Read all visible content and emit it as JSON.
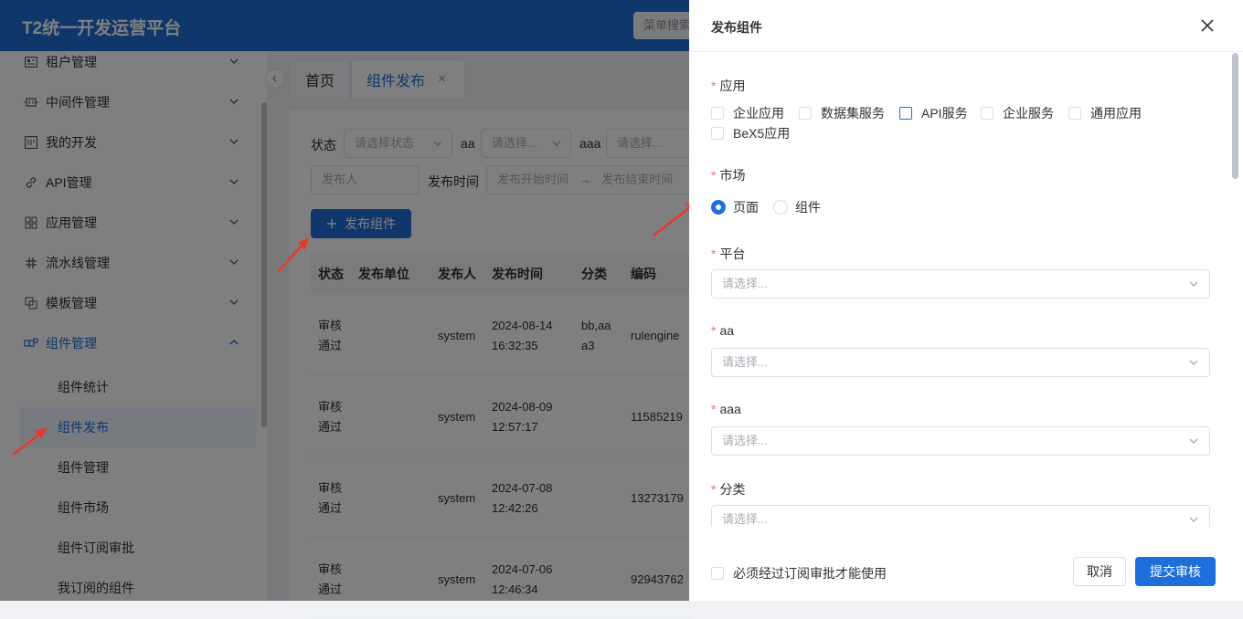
{
  "app": {
    "title": "T2统一开发运营平台",
    "menu_search_placeholder": "菜单搜索"
  },
  "sidebar": {
    "items": [
      {
        "label": "租户管理",
        "icon": "id-card-icon"
      },
      {
        "label": "中间件管理",
        "icon": "middleware-icon"
      },
      {
        "label": "我的开发",
        "icon": "code-window-icon"
      },
      {
        "label": "API管理",
        "icon": "link-icon"
      },
      {
        "label": "应用管理",
        "icon": "grid-icon"
      },
      {
        "label": "流水线管理",
        "icon": "pipeline-icon"
      },
      {
        "label": "模板管理",
        "icon": "template-icon"
      },
      {
        "label": "组件管理",
        "icon": "component-icon"
      }
    ],
    "sub_items": [
      "组件统计",
      "组件发布",
      "组件管理",
      "组件市场",
      "组件订阅审批",
      "我订阅的组件"
    ]
  },
  "tabs": {
    "home": "首页",
    "current": "组件发布",
    "close": "×"
  },
  "filters": {
    "status_label": "状态",
    "status_placeholder": "请选择状态",
    "aa_label": "aa",
    "aa_placeholder": "请选择...",
    "aaa_label": "aaa",
    "aaa_placeholder": "请选择...",
    "publisher_placeholder": "发布人",
    "time_label": "发布时间",
    "time_start": "发布开始时间",
    "time_sep": "→",
    "time_end": "发布结束时间"
  },
  "publish_button": "发布组件",
  "table": {
    "headers": [
      "状态",
      "发布单位",
      "发布人",
      "发布时间",
      "分类",
      "编码"
    ],
    "rows": [
      {
        "status1": "审核",
        "status2": "通过",
        "publisher": "system",
        "date": "2024-08-14",
        "time": "16:32:35",
        "cat1": "bb,aa",
        "cat2": "a3",
        "code": "rulengine"
      },
      {
        "status1": "审核",
        "status2": "通过",
        "publisher": "system",
        "date": "2024-08-09",
        "time": "12:57:17",
        "cat1": "",
        "cat2": "",
        "code": "11585219"
      },
      {
        "status1": "审核",
        "status2": "通过",
        "publisher": "system",
        "date": "2024-07-08",
        "time": "12:42:26",
        "cat1": "",
        "cat2": "",
        "code": "13273179"
      },
      {
        "status1": "审核",
        "status2": "通过",
        "publisher": "system",
        "date": "2024-07-06",
        "time": "12:46:34",
        "cat1": "",
        "cat2": "",
        "code": "92943762"
      }
    ]
  },
  "drawer": {
    "title": "发布组件",
    "required_mark": "*",
    "app_label": "应用",
    "app_options": [
      "企业应用",
      "数据集服务",
      "API服务",
      "企业服务",
      "通用应用",
      "BeX5应用"
    ],
    "market_label": "市场",
    "market_options": [
      "页面",
      "组件"
    ],
    "market_selected": "页面",
    "platform_label": "平台",
    "platform_placeholder": "请选择...",
    "aa_label": "aa",
    "aa_placeholder": "请选择...",
    "aaa_label": "aaa",
    "aaa_placeholder": "请选择...",
    "category_label": "分类",
    "category_placeholder": "请选择...",
    "must_approve": "必须经过订阅审批才能使用",
    "cancel": "取消",
    "submit": "提交审核"
  },
  "colors": {
    "primary": "#1e6fd9",
    "required": "#f56c6c",
    "annotation_arrow": "#e8392b"
  }
}
